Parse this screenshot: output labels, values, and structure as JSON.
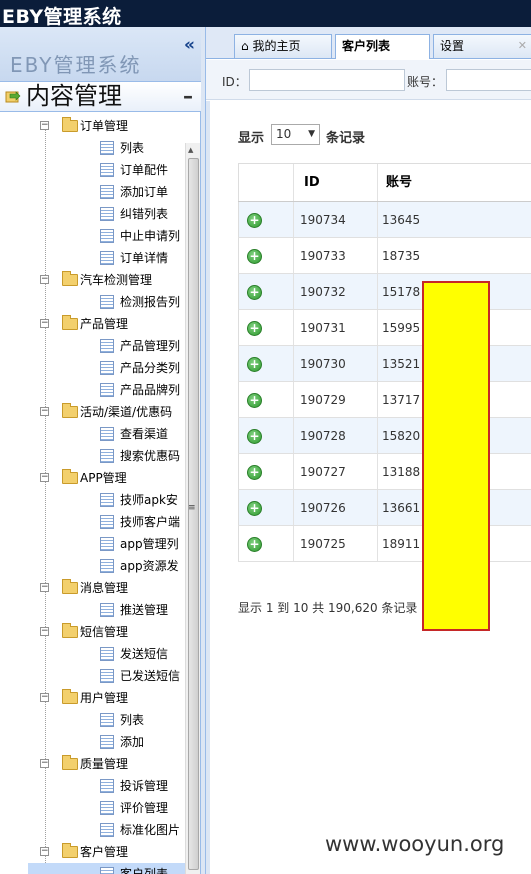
{
  "app": {
    "title": "EBY管理系统"
  },
  "west": {
    "ghost_title": "EBY管理系统",
    "collapse_glyph": "«",
    "panel_title": "内容管理",
    "panel_toggle": "–"
  },
  "tree": [
    {
      "type": "folder",
      "label": "订单管理"
    },
    {
      "type": "leaf",
      "label": "列表"
    },
    {
      "type": "leaf",
      "label": "订单配件"
    },
    {
      "type": "leaf",
      "label": "添加订单"
    },
    {
      "type": "leaf",
      "label": "纠错列表"
    },
    {
      "type": "leaf",
      "label": "中止申请列"
    },
    {
      "type": "leaf",
      "label": "订单详情"
    },
    {
      "type": "folder",
      "label": "汽车检测管理"
    },
    {
      "type": "leaf",
      "label": "检测报告列"
    },
    {
      "type": "folder",
      "label": "产品管理"
    },
    {
      "type": "leaf",
      "label": "产品管理列"
    },
    {
      "type": "leaf",
      "label": "产品分类列"
    },
    {
      "type": "leaf",
      "label": "产品品牌列"
    },
    {
      "type": "folder",
      "label": "活动/渠道/优惠码"
    },
    {
      "type": "leaf",
      "label": "查看渠道"
    },
    {
      "type": "leaf",
      "label": "搜索优惠码"
    },
    {
      "type": "folder",
      "label": "APP管理"
    },
    {
      "type": "leaf",
      "label": "技师apk安"
    },
    {
      "type": "leaf",
      "label": "技师客户端"
    },
    {
      "type": "leaf",
      "label": "app管理列"
    },
    {
      "type": "leaf",
      "label": "app资源发"
    },
    {
      "type": "folder",
      "label": "消息管理"
    },
    {
      "type": "leaf",
      "label": "推送管理"
    },
    {
      "type": "folder",
      "label": "短信管理"
    },
    {
      "type": "leaf",
      "label": "发送短信"
    },
    {
      "type": "leaf",
      "label": "已发送短信"
    },
    {
      "type": "folder",
      "label": "用户管理"
    },
    {
      "type": "leaf",
      "label": "列表"
    },
    {
      "type": "leaf",
      "label": "添加"
    },
    {
      "type": "folder",
      "label": "质量管理"
    },
    {
      "type": "leaf",
      "label": "投诉管理"
    },
    {
      "type": "leaf",
      "label": "评价管理"
    },
    {
      "type": "leaf",
      "label": "标准化图片"
    },
    {
      "type": "folder",
      "label": "客户管理"
    },
    {
      "type": "leaf",
      "label": "客户列表",
      "selected": true
    }
  ],
  "tabs": [
    {
      "label": "我的主页",
      "icon": "home-icon"
    },
    {
      "label": "客户列表",
      "active": true
    },
    {
      "label": "设置"
    }
  ],
  "search": {
    "id_label": "ID：",
    "account_label": "账号："
  },
  "table": {
    "show_label": "显示",
    "page_size": "10",
    "records_label": "条记录",
    "columns": [
      "",
      "ID",
      "账号"
    ],
    "rows": [
      {
        "id": "190734",
        "account": "13645"
      },
      {
        "id": "190733",
        "account": "18735"
      },
      {
        "id": "190732",
        "account": "15178"
      },
      {
        "id": "190731",
        "account": "15995"
      },
      {
        "id": "190730",
        "account": "13521"
      },
      {
        "id": "190729",
        "account": "13717"
      },
      {
        "id": "190728",
        "account": "15820"
      },
      {
        "id": "190727",
        "account": "13188"
      },
      {
        "id": "190726",
        "account": "13661"
      },
      {
        "id": "190725",
        "account": "18911"
      }
    ],
    "info": "显示 1 到 10 共 190,620 条记录"
  },
  "watermark": "www.wooyun.org",
  "colors": {
    "header_bg": "#0b1d3a",
    "redaction_fill": "#ffff00",
    "redaction_border": "#c62828"
  }
}
